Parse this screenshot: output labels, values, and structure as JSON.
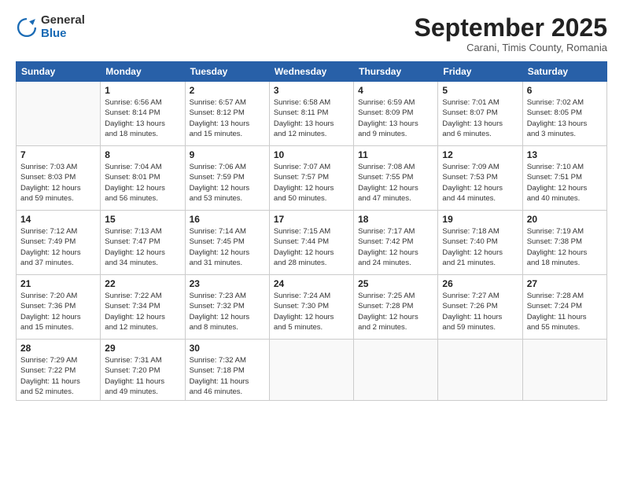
{
  "logo": {
    "general": "General",
    "blue": "Blue"
  },
  "title": "September 2025",
  "subtitle": "Carani, Timis County, Romania",
  "header_days": [
    "Sunday",
    "Monday",
    "Tuesday",
    "Wednesday",
    "Thursday",
    "Friday",
    "Saturday"
  ],
  "weeks": [
    [
      {
        "day": "",
        "info": ""
      },
      {
        "day": "1",
        "info": "Sunrise: 6:56 AM\nSunset: 8:14 PM\nDaylight: 13 hours\nand 18 minutes."
      },
      {
        "day": "2",
        "info": "Sunrise: 6:57 AM\nSunset: 8:12 PM\nDaylight: 13 hours\nand 15 minutes."
      },
      {
        "day": "3",
        "info": "Sunrise: 6:58 AM\nSunset: 8:11 PM\nDaylight: 13 hours\nand 12 minutes."
      },
      {
        "day": "4",
        "info": "Sunrise: 6:59 AM\nSunset: 8:09 PM\nDaylight: 13 hours\nand 9 minutes."
      },
      {
        "day": "5",
        "info": "Sunrise: 7:01 AM\nSunset: 8:07 PM\nDaylight: 13 hours\nand 6 minutes."
      },
      {
        "day": "6",
        "info": "Sunrise: 7:02 AM\nSunset: 8:05 PM\nDaylight: 13 hours\nand 3 minutes."
      }
    ],
    [
      {
        "day": "7",
        "info": "Sunrise: 7:03 AM\nSunset: 8:03 PM\nDaylight: 12 hours\nand 59 minutes."
      },
      {
        "day": "8",
        "info": "Sunrise: 7:04 AM\nSunset: 8:01 PM\nDaylight: 12 hours\nand 56 minutes."
      },
      {
        "day": "9",
        "info": "Sunrise: 7:06 AM\nSunset: 7:59 PM\nDaylight: 12 hours\nand 53 minutes."
      },
      {
        "day": "10",
        "info": "Sunrise: 7:07 AM\nSunset: 7:57 PM\nDaylight: 12 hours\nand 50 minutes."
      },
      {
        "day": "11",
        "info": "Sunrise: 7:08 AM\nSunset: 7:55 PM\nDaylight: 12 hours\nand 47 minutes."
      },
      {
        "day": "12",
        "info": "Sunrise: 7:09 AM\nSunset: 7:53 PM\nDaylight: 12 hours\nand 44 minutes."
      },
      {
        "day": "13",
        "info": "Sunrise: 7:10 AM\nSunset: 7:51 PM\nDaylight: 12 hours\nand 40 minutes."
      }
    ],
    [
      {
        "day": "14",
        "info": "Sunrise: 7:12 AM\nSunset: 7:49 PM\nDaylight: 12 hours\nand 37 minutes."
      },
      {
        "day": "15",
        "info": "Sunrise: 7:13 AM\nSunset: 7:47 PM\nDaylight: 12 hours\nand 34 minutes."
      },
      {
        "day": "16",
        "info": "Sunrise: 7:14 AM\nSunset: 7:45 PM\nDaylight: 12 hours\nand 31 minutes."
      },
      {
        "day": "17",
        "info": "Sunrise: 7:15 AM\nSunset: 7:44 PM\nDaylight: 12 hours\nand 28 minutes."
      },
      {
        "day": "18",
        "info": "Sunrise: 7:17 AM\nSunset: 7:42 PM\nDaylight: 12 hours\nand 24 minutes."
      },
      {
        "day": "19",
        "info": "Sunrise: 7:18 AM\nSunset: 7:40 PM\nDaylight: 12 hours\nand 21 minutes."
      },
      {
        "day": "20",
        "info": "Sunrise: 7:19 AM\nSunset: 7:38 PM\nDaylight: 12 hours\nand 18 minutes."
      }
    ],
    [
      {
        "day": "21",
        "info": "Sunrise: 7:20 AM\nSunset: 7:36 PM\nDaylight: 12 hours\nand 15 minutes."
      },
      {
        "day": "22",
        "info": "Sunrise: 7:22 AM\nSunset: 7:34 PM\nDaylight: 12 hours\nand 12 minutes."
      },
      {
        "day": "23",
        "info": "Sunrise: 7:23 AM\nSunset: 7:32 PM\nDaylight: 12 hours\nand 8 minutes."
      },
      {
        "day": "24",
        "info": "Sunrise: 7:24 AM\nSunset: 7:30 PM\nDaylight: 12 hours\nand 5 minutes."
      },
      {
        "day": "25",
        "info": "Sunrise: 7:25 AM\nSunset: 7:28 PM\nDaylight: 12 hours\nand 2 minutes."
      },
      {
        "day": "26",
        "info": "Sunrise: 7:27 AM\nSunset: 7:26 PM\nDaylight: 11 hours\nand 59 minutes."
      },
      {
        "day": "27",
        "info": "Sunrise: 7:28 AM\nSunset: 7:24 PM\nDaylight: 11 hours\nand 55 minutes."
      }
    ],
    [
      {
        "day": "28",
        "info": "Sunrise: 7:29 AM\nSunset: 7:22 PM\nDaylight: 11 hours\nand 52 minutes."
      },
      {
        "day": "29",
        "info": "Sunrise: 7:31 AM\nSunset: 7:20 PM\nDaylight: 11 hours\nand 49 minutes."
      },
      {
        "day": "30",
        "info": "Sunrise: 7:32 AM\nSunset: 7:18 PM\nDaylight: 11 hours\nand 46 minutes."
      },
      {
        "day": "",
        "info": ""
      },
      {
        "day": "",
        "info": ""
      },
      {
        "day": "",
        "info": ""
      },
      {
        "day": "",
        "info": ""
      }
    ]
  ]
}
